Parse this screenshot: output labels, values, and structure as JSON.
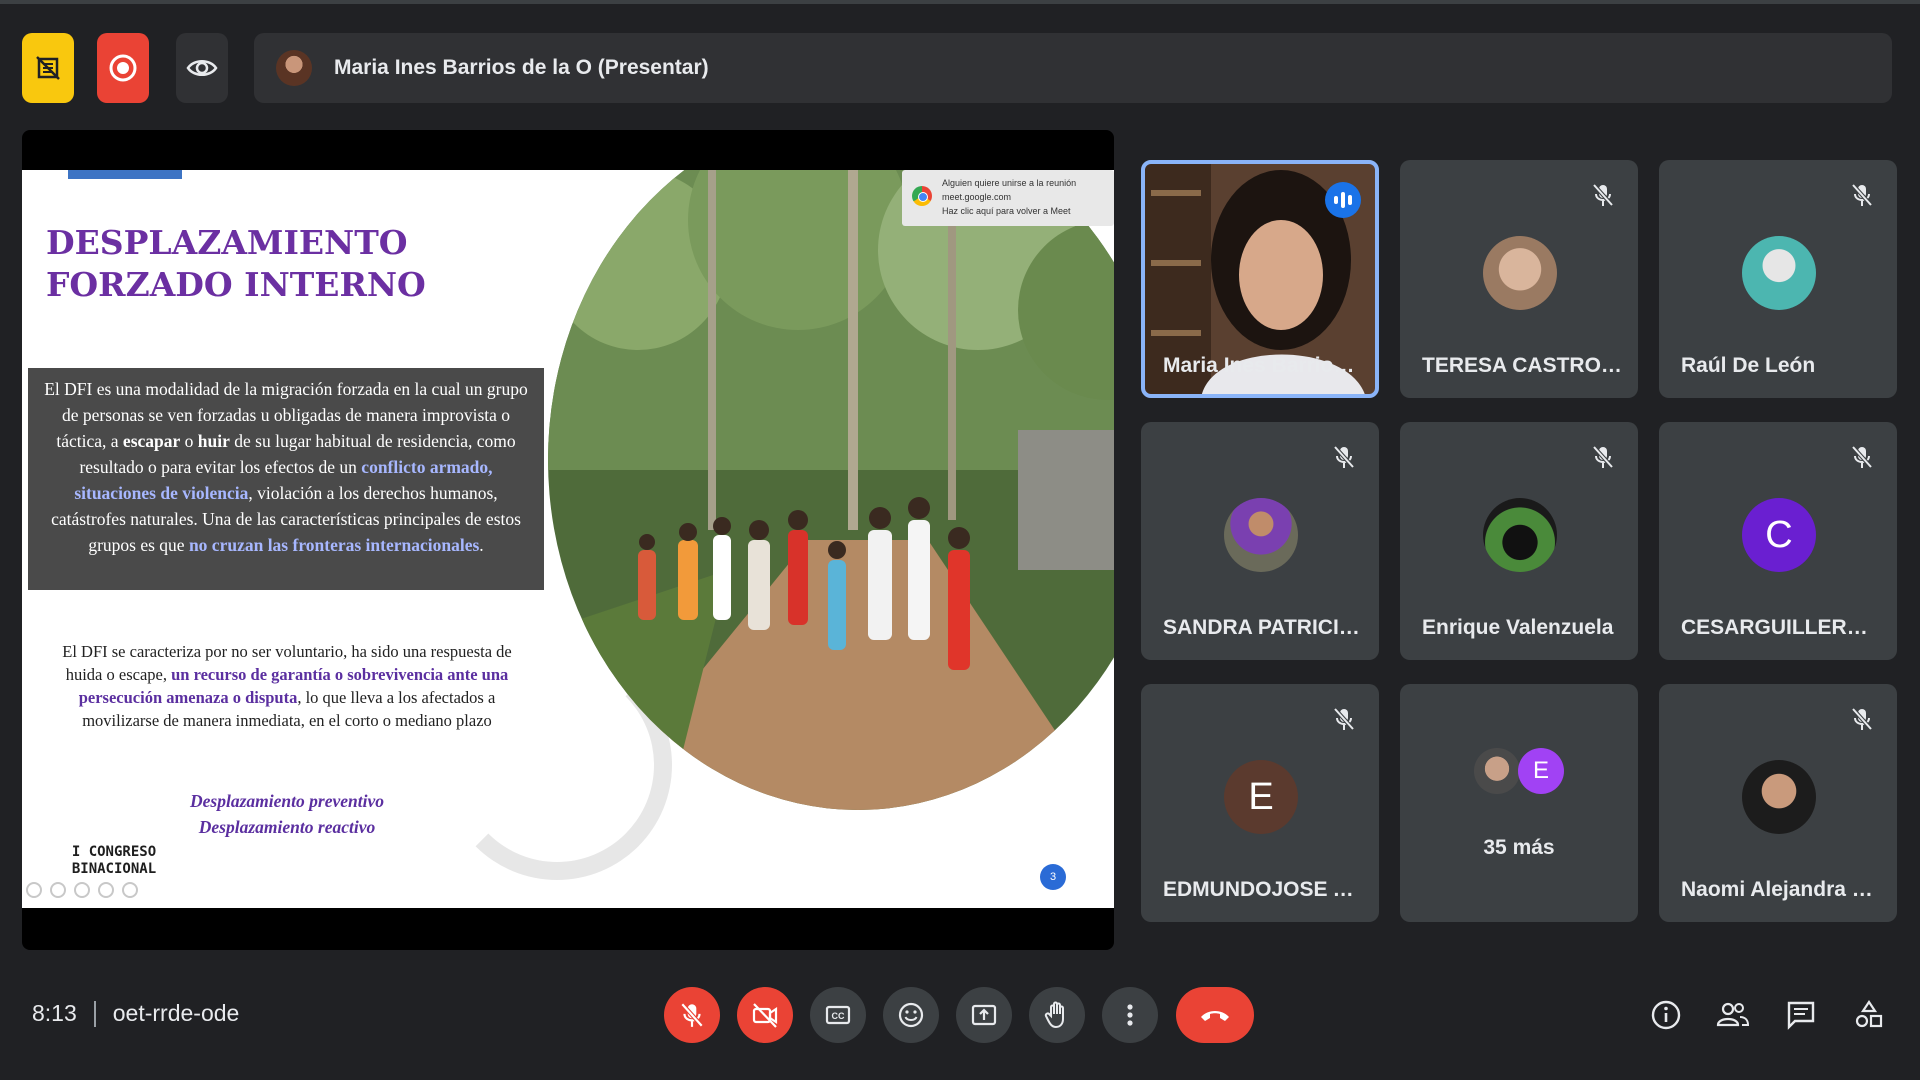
{
  "presenter": {
    "name": "Maria Ines Barrios de la O (Presentar)"
  },
  "toolbar_top": {
    "no_sign_icon": "no-sign-icon",
    "record_icon": "record-icon",
    "eye_icon": "eye-icon"
  },
  "slide": {
    "title": "DESPLAZAMIENTO FORZADO INTERNO",
    "box_parts": [
      "El DFI es una modalidad de la migración forzada en la cual un grupo de personas se ven forzadas u obligadas de manera improvista o táctica, a ",
      "escapar",
      " o ",
      "huir",
      " de su lugar habitual de residencia, como resultado o para evitar los efectos de un ",
      "conflicto armado, situaciones de violencia",
      ", violación a los derechos humanos, catástrofes naturales. Una de las características principales de estos grupos es que ",
      "no cruzan las fronteras internacionales",
      "."
    ],
    "para_parts": [
      "El DFI se caracteriza por no ser voluntario, ha sido una respuesta de huida o escape, ",
      "un recurso de garantía o sobrevivencia ante una persecución amenaza o disputa",
      ", lo que lleva a los afectados a movilizarse de manera inmediata, en el corto o mediano plazo"
    ],
    "type_1": "Desplazamiento preventivo",
    "type_2": "Desplazamiento reactivo",
    "logo_line1": "I CONGRESO",
    "logo_line2": "BINACIONAL",
    "page_num": "3",
    "toast_line1": "Alguien quiere unirse a la reunión",
    "toast_line2": "meet.google.com",
    "toast_line3": "Haz clic aquí para volver a Meet"
  },
  "participants": [
    {
      "name": "Maria Ines Barrios ...",
      "speaking": true
    },
    {
      "name": "TERESA CASTRO M...",
      "muted": true
    },
    {
      "name": "Raúl De León",
      "muted": true
    },
    {
      "name": "SANDRA PATRICIA ...",
      "muted": true
    },
    {
      "name": "Enrique Valenzuela",
      "muted": true
    },
    {
      "name": "CESARGUILLERMO...",
      "muted": true,
      "initial": "C",
      "color": "#6a1fd1"
    },
    {
      "name": "EDMUNDOJOSE A...",
      "muted": true,
      "initial": "E",
      "color": "#5b3a2e"
    },
    {
      "name": "",
      "initial": "E",
      "color": "#a142f4",
      "more_label": "35 más"
    },
    {
      "name": "Naomi Alejandra G...",
      "muted": true
    }
  ],
  "meeting": {
    "time": "8:13",
    "code": "oet-rrde-ode"
  },
  "controls": {
    "mic": "mic-off-icon",
    "camera": "camera-off-icon",
    "captions": "captions-icon",
    "emoji": "emoji-icon",
    "present": "present-icon",
    "hand": "raise-hand-icon",
    "more": "more-vert-icon",
    "end": "end-call-icon"
  },
  "colors": {
    "accent": "#8ab4f8",
    "danger": "#ea4335",
    "bg": "#202124",
    "tile": "#3c4043"
  }
}
